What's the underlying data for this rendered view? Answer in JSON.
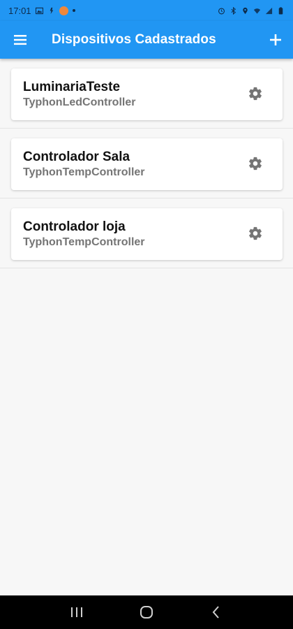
{
  "status_bar": {
    "time": "17:01",
    "left_icons": [
      "image-icon",
      "notification-icon",
      "app-badge-icon",
      "dot-icon"
    ],
    "right_icons": [
      "alarm-icon",
      "bluetooth-icon",
      "location-icon",
      "wifi-icon",
      "signal-icon",
      "battery-icon"
    ]
  },
  "app_bar": {
    "title": "Dispositivos Cadastrados",
    "menu_icon": "menu-icon",
    "add_icon": "add-icon",
    "color": "#2196f3"
  },
  "devices": [
    {
      "name": "LuminariaTeste",
      "type": "TyphonLedController",
      "action_icon": "gear-icon"
    },
    {
      "name": "Controlador Sala",
      "type": "TyphonTempController",
      "action_icon": "gear-icon"
    },
    {
      "name": "Controlador loja",
      "type": "TyphonTempController",
      "action_icon": "gear-icon"
    }
  ],
  "nav_bar": {
    "buttons": [
      "recent-apps-icon",
      "home-icon",
      "back-icon"
    ]
  }
}
